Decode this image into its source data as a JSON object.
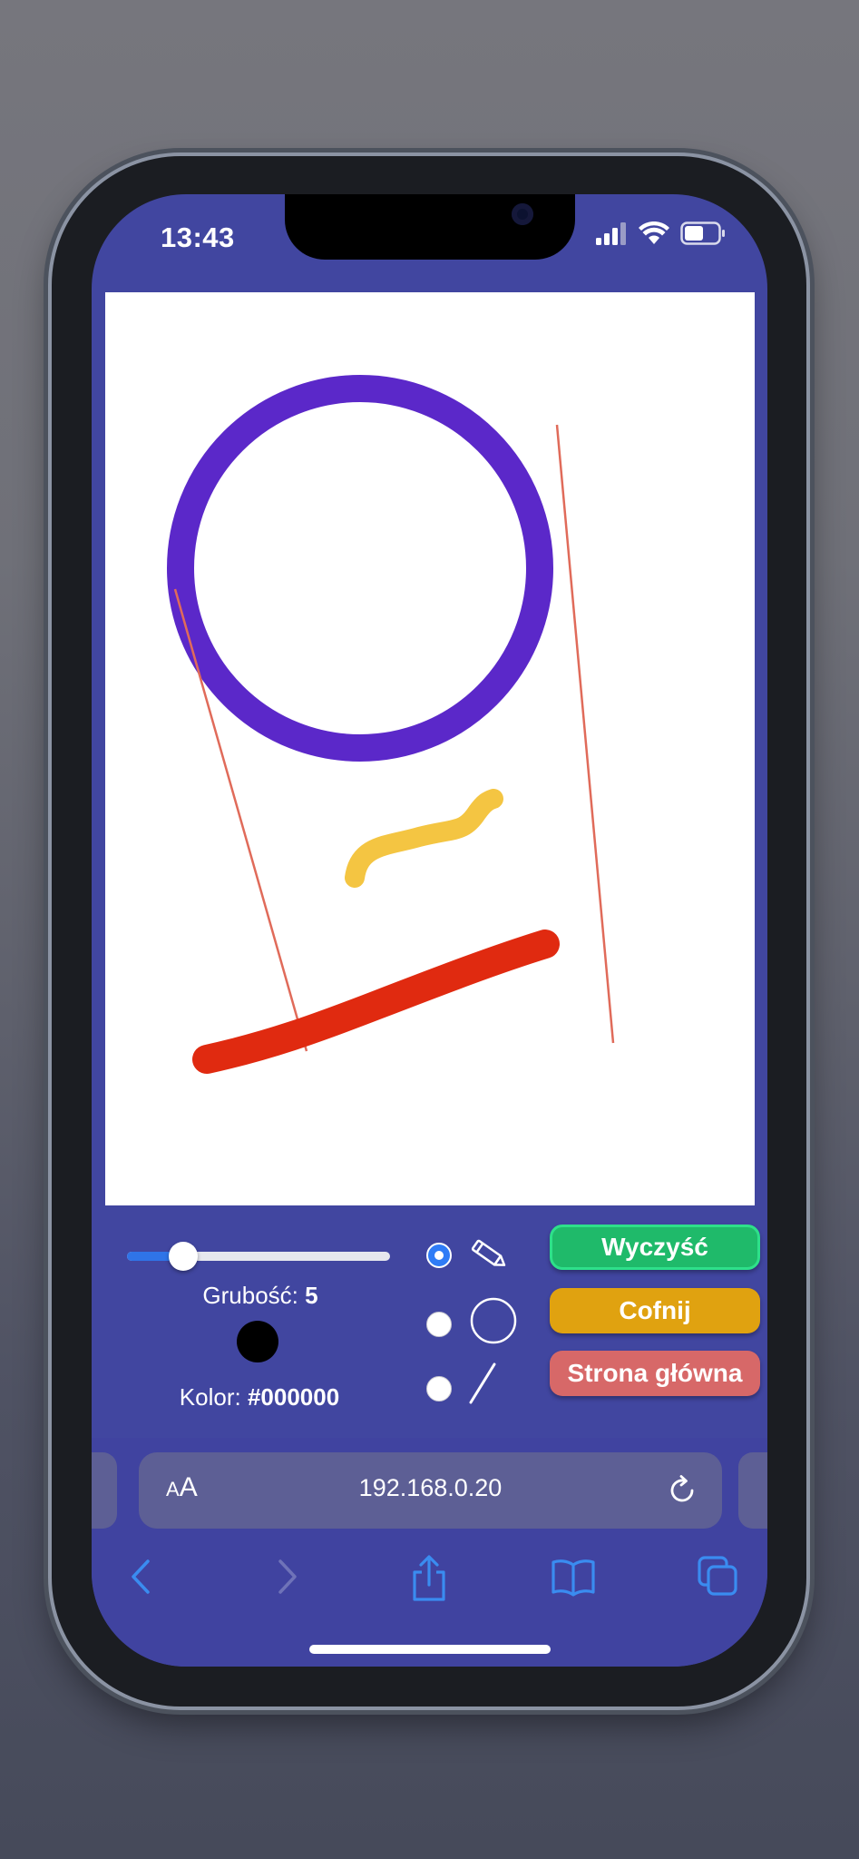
{
  "status_bar": {
    "time": "13:43"
  },
  "controls": {
    "thickness_label": "Grubość:",
    "thickness_value": "5",
    "thickness_fraction": 0.18,
    "color_label": "Kolor:",
    "color_value": "#000000",
    "tools": [
      {
        "name": "pencil",
        "icon": "pencil-icon",
        "selected": true
      },
      {
        "name": "circle",
        "icon": "circle-icon",
        "selected": false
      },
      {
        "name": "line",
        "icon": "line-icon",
        "selected": false
      }
    ],
    "buttons": {
      "clear": "Wyczyść",
      "undo": "Cofnij",
      "home": "Strona główna"
    }
  },
  "canvas_colors": {
    "circle": "#5b28c9",
    "wavy": "#f4c542",
    "thick_stroke": "#e02a10",
    "thin_lines": "#e06b5a"
  },
  "browser": {
    "text_size_button": "AA",
    "url": "192.168.0.20"
  }
}
